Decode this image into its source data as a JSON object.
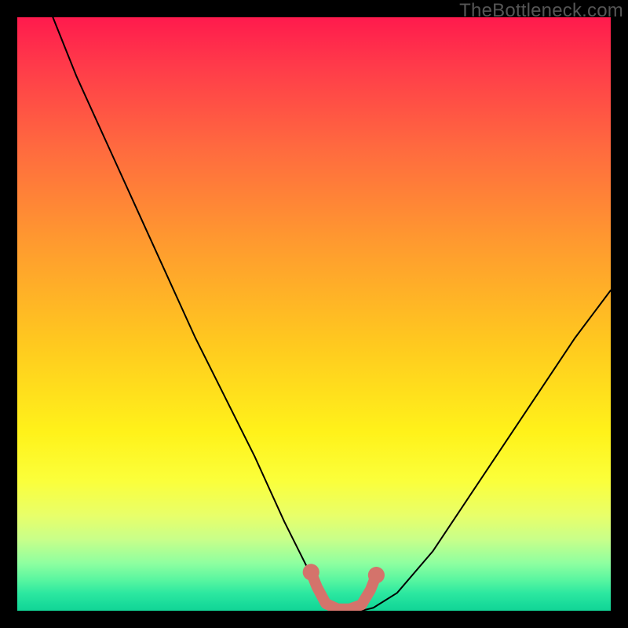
{
  "watermark": {
    "text": "TheBottleneck.com"
  },
  "chart_data": {
    "type": "line",
    "title": "",
    "xlabel": "",
    "ylabel": "",
    "xlim": [
      0,
      100
    ],
    "ylim": [
      0,
      100
    ],
    "grid": false,
    "series": [
      {
        "name": "bottleneck-curve",
        "color": "#000000",
        "x": [
          6,
          10,
          15,
          20,
          25,
          30,
          35,
          40,
          45,
          48,
          50,
          52,
          54,
          56,
          58,
          60,
          64,
          70,
          76,
          82,
          88,
          94,
          100
        ],
        "y": [
          100,
          90,
          79,
          68,
          57,
          46,
          36,
          26,
          15,
          9,
          5,
          2,
          0.5,
          0,
          0,
          0.5,
          3,
          10,
          19,
          28,
          37,
          46,
          54
        ]
      },
      {
        "name": "optimal-band",
        "color": "#d4736b",
        "x": [
          49.5,
          50.5,
          52,
          54,
          56,
          58,
          59.5,
          60.5
        ],
        "y": [
          6.5,
          4,
          1.2,
          0.3,
          0.3,
          1,
          3.5,
          6
        ]
      }
    ],
    "markers": [
      {
        "name": "left-dot",
        "x": 49.5,
        "y": 6.5,
        "r": 1.4,
        "color": "#d4736b"
      },
      {
        "name": "right-dot",
        "x": 60.5,
        "y": 6.0,
        "r": 1.4,
        "color": "#d4736b"
      }
    ]
  }
}
